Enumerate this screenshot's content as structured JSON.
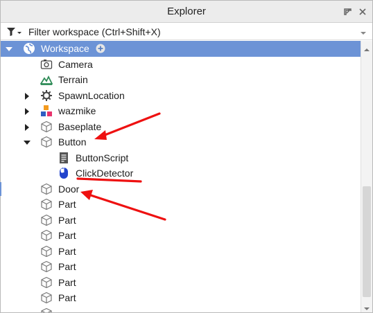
{
  "window": {
    "title": "Explorer"
  },
  "filter": {
    "placeholder": "Filter workspace (Ctrl+Shift+X)"
  },
  "tree": {
    "items": [
      {
        "label": "Workspace",
        "icon": "workspace-globe-icon",
        "expanded": true,
        "selected": true
      },
      {
        "label": "Camera",
        "icon": "camera-icon"
      },
      {
        "label": "Terrain",
        "icon": "terrain-icon"
      },
      {
        "label": "SpawnLocation",
        "icon": "spawn-gear-icon",
        "collapsed": true
      },
      {
        "label": "wazmike",
        "icon": "model-icon",
        "collapsed": true
      },
      {
        "label": "Baseplate",
        "icon": "part-cube-icon",
        "collapsed": true
      },
      {
        "label": "Button",
        "icon": "part-cube-icon",
        "expanded": true
      },
      {
        "label": "ButtonScript",
        "icon": "script-icon"
      },
      {
        "label": "ClickDetector",
        "icon": "click-detector-icon"
      },
      {
        "label": "Door",
        "icon": "part-cube-icon"
      },
      {
        "label": "Part",
        "icon": "part-cube-icon"
      },
      {
        "label": "Part",
        "icon": "part-cube-icon"
      },
      {
        "label": "Part",
        "icon": "part-cube-icon"
      },
      {
        "label": "Part",
        "icon": "part-cube-icon"
      },
      {
        "label": "Part",
        "icon": "part-cube-icon"
      },
      {
        "label": "Part",
        "icon": "part-cube-icon"
      },
      {
        "label": "Part",
        "icon": "part-cube-icon"
      }
    ]
  },
  "colors": {
    "selection": "#6c93d6",
    "annotation": "#ee1111",
    "terrain": "#2e8b57",
    "click_detector": "#2244cc"
  }
}
